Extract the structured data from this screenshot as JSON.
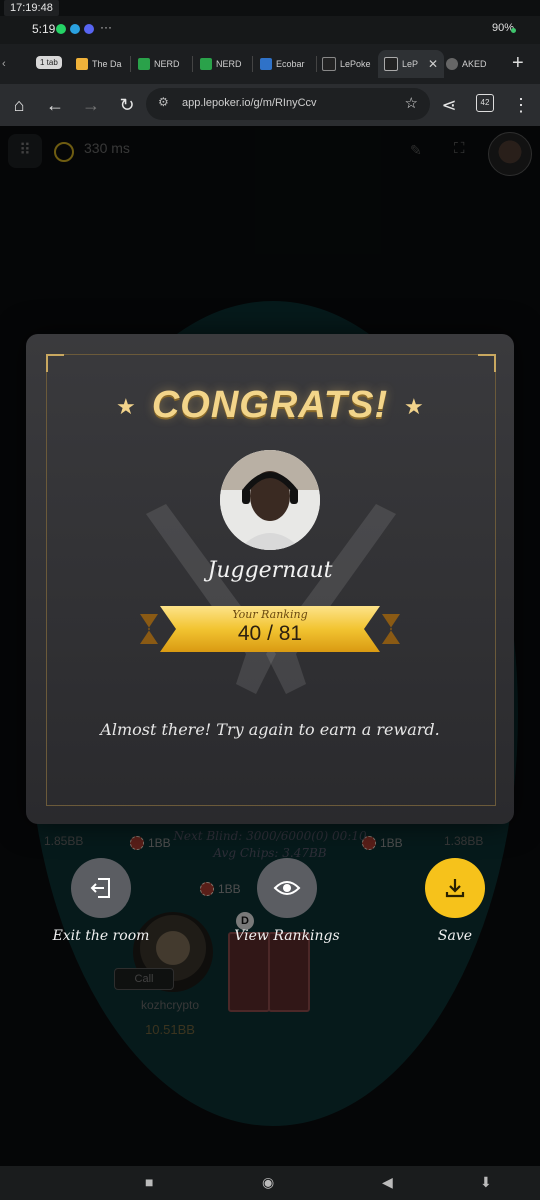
{
  "system": {
    "clock_chip": "17:19:48",
    "time": "5:19",
    "status_right": "90%",
    "more": "···"
  },
  "browser": {
    "tabs": [
      {
        "label": "The Da",
        "color": "#f0b23a"
      },
      {
        "label": "NERD",
        "color": "#2aa24a"
      },
      {
        "label": "NERD",
        "color": "#2aa24a"
      },
      {
        "label": "Ecobar",
        "color": "#2f72c8"
      },
      {
        "label": "LePoke",
        "color": "#888888"
      },
      {
        "label": "LeP",
        "color": "#aaaaaa"
      },
      {
        "label": "AKED",
        "color": "#666666"
      }
    ],
    "tab_group_chip": "1 tab",
    "url": "app.lepoker.io/g/m/RInyCcv",
    "tab_count": "42"
  },
  "game": {
    "ping": "330 ms",
    "left_stack": "1.85BB",
    "right_stack": "1.38BB",
    "left_bet": "1BB",
    "right_bet": "1BB",
    "center_bet": "1BB",
    "blinds_line1": "Next Blind: 3000/6000(0) 00:10",
    "blinds_line2": "Avg Chips: 3.47BB",
    "bottom_player": {
      "name": "kozhcrypto",
      "stack": "10.51BB",
      "action": "Call"
    },
    "dealer_label": "D"
  },
  "modal": {
    "title": "CONGRATS!",
    "player_name": "Juggernaut",
    "ranking_label": "Your Ranking",
    "ranking_value": "40 / 81",
    "message": "Almost there! Try again to earn a reward."
  },
  "actions": {
    "exit_label": "Exit the room",
    "rankings_label": "View Rankings",
    "save_label": "Save"
  },
  "colors": {
    "accent_gold": "#f3d58a",
    "save_yellow": "#f6c21b",
    "table_teal": "#0f4f52"
  }
}
